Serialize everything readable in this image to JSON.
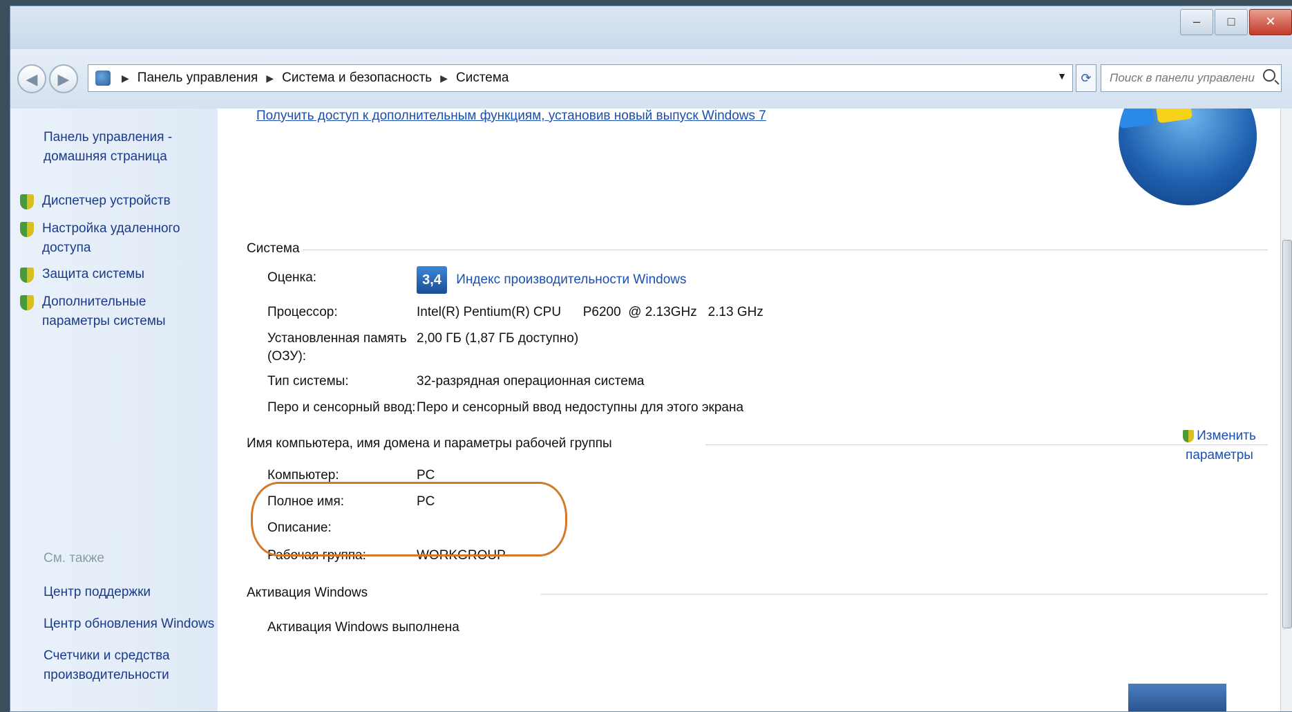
{
  "breadcrumb": [
    "Панель управления",
    "Система и безопасность",
    "Система"
  ],
  "search": {
    "placeholder": "Поиск в панели управления"
  },
  "sidebar": {
    "home_link": "Панель управления - домашняя страница",
    "items": [
      {
        "label": "Диспетчер устройств"
      },
      {
        "label": "Настройка удаленного доступа"
      },
      {
        "label": "Защита системы"
      },
      {
        "label": "Дополнительные параметры системы"
      }
    ],
    "see_also_header": "См. также",
    "see_also": [
      {
        "label": "Центр поддержки"
      },
      {
        "label": "Центр обновления Windows"
      },
      {
        "label": "Счетчики и средства производительности"
      }
    ]
  },
  "main": {
    "top_link": "Получить доступ к дополнительным функциям, установив новый выпуск Windows 7",
    "system_section": {
      "title": "Система",
      "rating_label": "Оценка:",
      "rating_score": "3,4",
      "rating_link": "Индекс производительности Windows",
      "cpu_label": "Процессор:",
      "cpu_value": "Intel(R) Pentium(R) CPU      P6200  @ 2.13GHz   2.13 GHz",
      "ram_label": "Установленная память (ОЗУ):",
      "ram_value": "2,00 ГБ (1,87 ГБ доступно)",
      "type_label": "Тип системы:",
      "type_value": "32-разрядная операционная система",
      "pen_label": "Перо и сенсорный ввод:",
      "pen_value": "Перо и сенсорный ввод недоступны для этого экрана"
    },
    "computer_section": {
      "title": "Имя компьютера, имя домена и параметры рабочей группы",
      "computer_label": "Компьютер:",
      "computer_value": "PC",
      "fullname_label": "Полное имя:",
      "fullname_value": "PC",
      "description_label": "Описание:",
      "workgroup_label": "Рабочая группа:",
      "workgroup_value": "WORKGROUP",
      "change_link": "Изменить параметры"
    },
    "activation_section": {
      "title": "Активация Windows",
      "status": "Активация Windows выполнена"
    }
  },
  "colors": {
    "link": "#1a4fb0",
    "highlight_circle": "#d07a2a"
  }
}
